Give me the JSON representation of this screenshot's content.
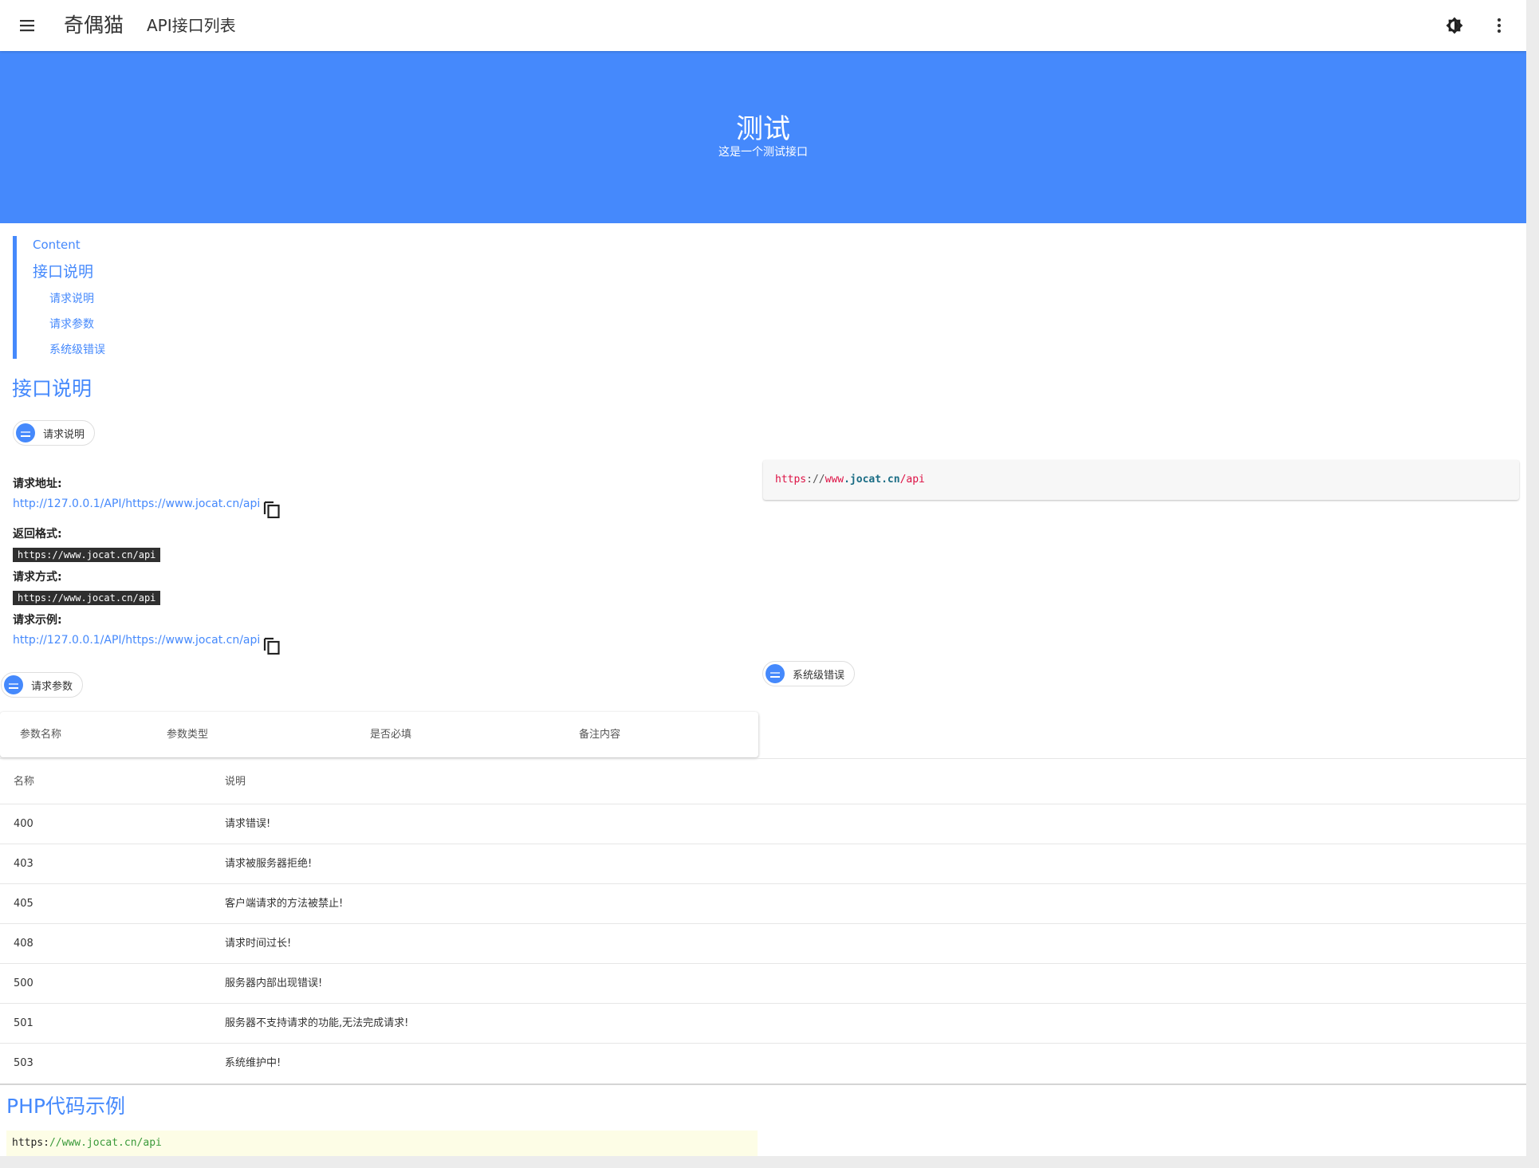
{
  "appbar": {
    "brand": "奇偶猫",
    "subtitle": "API接口列表",
    "menu_icon": "menu-icon",
    "theme_icon": "brightness-icon",
    "more_icon": "more-vert-icon"
  },
  "hero": {
    "title": "测试",
    "description": "这是一个测试接口",
    "color": "#4589fc"
  },
  "toc": {
    "content": "Content",
    "items": [
      {
        "label": "接口说明",
        "level": 1
      },
      {
        "label": "请求说明",
        "level": 2
      },
      {
        "label": "请求参数",
        "level": 2
      },
      {
        "label": "系统级错误",
        "level": 2
      }
    ]
  },
  "api_section": {
    "title": "接口说明",
    "request_chip": "请求说明",
    "request": {
      "address_label": "请求地址:",
      "address_value": "http://127.0.0.1/API/https://www.jocat.cn/api",
      "format_label": "返回格式:",
      "format_value": "https://www.jocat.cn/api",
      "method_label": "请求方式:",
      "method_value": "https://www.jocat.cn/api",
      "example_label": "请求示例:",
      "example_value": "http://127.0.0.1/API/https://www.jocat.cn/api"
    },
    "code_block": {
      "proto": "https",
      "sep1": "://",
      "www": "www",
      "host": ".jocat.cn",
      "path": "/api"
    },
    "params_chip": "请求参数",
    "params_headers": [
      "参数名称",
      "参数类型",
      "是否必填",
      "备注内容"
    ],
    "errors_chip": "系统级错误",
    "errors_headers": [
      "名称",
      "说明"
    ],
    "errors": [
      {
        "code": "400",
        "desc": "请求错误!"
      },
      {
        "code": "403",
        "desc": "请求被服务器拒绝!"
      },
      {
        "code": "405",
        "desc": "客户端请求的方法被禁止!"
      },
      {
        "code": "408",
        "desc": "请求时间过长!"
      },
      {
        "code": "500",
        "desc": "服务器内部出现错误!"
      },
      {
        "code": "501",
        "desc": "服务器不支持请求的功能,无法完成请求!"
      },
      {
        "code": "503",
        "desc": "系统维护中!"
      }
    ]
  },
  "php_section": {
    "title": "PHP代码示例",
    "code_prefix": "https:",
    "code_rest": "//www.jocat.cn/api"
  }
}
